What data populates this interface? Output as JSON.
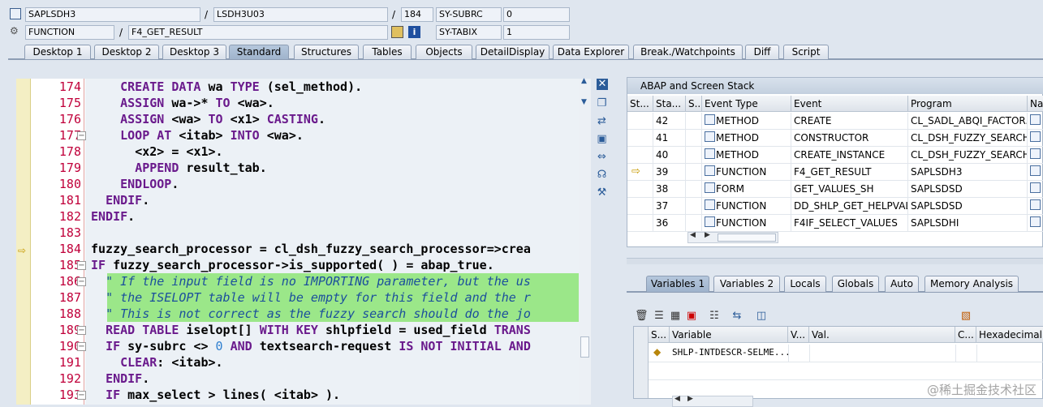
{
  "header": {
    "row1": {
      "program": "SAPLSDH3",
      "include": "LSDH3U03",
      "line": "184",
      "sysfield": "SY-SUBRC",
      "sysvalue": "0"
    },
    "row2": {
      "type": "FUNCTION",
      "name": "F4_GET_RESULT",
      "sysfield": "SY-TABIX",
      "sysvalue": "1"
    }
  },
  "tabs": [
    "Desktop 1",
    "Desktop 2",
    "Desktop 3",
    "Standard",
    "Structures",
    "Tables",
    "Objects",
    "DetailDisplay",
    "Data Explorer",
    "Break./Watchpoints",
    "Diff",
    "Script"
  ],
  "active_tab": "Standard",
  "editor": {
    "lines": [
      {
        "n": "174",
        "text": "    CREATE DATA wa TYPE (sel_method)."
      },
      {
        "n": "175",
        "text": "    ASSIGN wa->* TO <wa>."
      },
      {
        "n": "176",
        "text": "    ASSIGN <wa> TO <x1> CASTING."
      },
      {
        "n": "177",
        "text": "    LOOP AT <itab> INTO <wa>."
      },
      {
        "n": "178",
        "text": "      <x2> = <x1>."
      },
      {
        "n": "179",
        "text": "      APPEND result_tab."
      },
      {
        "n": "180",
        "text": "    ENDLOOP."
      },
      {
        "n": "181",
        "text": "  ENDIF."
      },
      {
        "n": "182",
        "text": "ENDIF."
      },
      {
        "n": "183",
        "text": ""
      },
      {
        "n": "184",
        "text": "fuzzy_search_processor = cl_dsh_fuzzy_search_processor=>crea"
      },
      {
        "n": "185",
        "text": "IF fuzzy_search_processor->is_supported( ) = abap_true."
      },
      {
        "n": "186",
        "text": "  \" If the input field is no IMPORTING parameter, but the us"
      },
      {
        "n": "187",
        "text": "  \" the ISELOPT table will be empty for this field and the r"
      },
      {
        "n": "188",
        "text": "  \" This is not correct as the fuzzy search should do the jo"
      },
      {
        "n": "189",
        "text": "  READ TABLE iselopt[] WITH KEY shlpfield = used_field TRANS"
      },
      {
        "n": "190",
        "text": "  IF sy-subrc <> 0 AND textsearch-request IS NOT INITIAL AND"
      },
      {
        "n": "191",
        "text": "    CLEAR: <itab>."
      },
      {
        "n": "192",
        "text": "  ENDIF."
      },
      {
        "n": "193",
        "text": "  IF max_select > lines( <itab> )."
      }
    ]
  },
  "stack": {
    "title": "ABAP and Screen Stack",
    "columns": [
      "St...",
      "Sta...",
      "S...",
      "Event Type",
      "Event",
      "Program",
      "Na..."
    ],
    "rows": [
      {
        "level": "42",
        "type": "METHOD",
        "event": "CREATE",
        "program": "CL_SADL_ABQI_FACTOR..."
      },
      {
        "level": "41",
        "type": "METHOD",
        "event": "CONSTRUCTOR",
        "program": "CL_DSH_FUZZY_SEARCH..."
      },
      {
        "level": "40",
        "type": "METHOD",
        "event": "CREATE_INSTANCE",
        "program": "CL_DSH_FUZZY_SEARCH..."
      },
      {
        "level": "39",
        "type": "FUNCTION",
        "event": "F4_GET_RESULT",
        "program": "SAPLSDH3"
      },
      {
        "level": "38",
        "type": "FORM",
        "event": "GET_VALUES_SH",
        "program": "SAPLSDSD"
      },
      {
        "level": "37",
        "type": "FUNCTION",
        "event": "DD_SHLP_GET_HELPVAL...",
        "program": "SAPLSDSD"
      },
      {
        "level": "36",
        "type": "FUNCTION",
        "event": "F4IF_SELECT_VALUES",
        "program": "SAPLSDHI"
      }
    ]
  },
  "variables": {
    "tabs": [
      "Variables 1",
      "Variables 2",
      "Locals",
      "Globals",
      "Auto",
      "Memory Analysis"
    ],
    "columns": [
      "S...",
      "Variable",
      "V...",
      "Val.",
      "C...",
      "Hexadecimal Va"
    ],
    "rows": [
      {
        "variable": "SHLP-INTDESCR-SELME..."
      }
    ]
  },
  "watermark": "@稀土掘金技术社区"
}
